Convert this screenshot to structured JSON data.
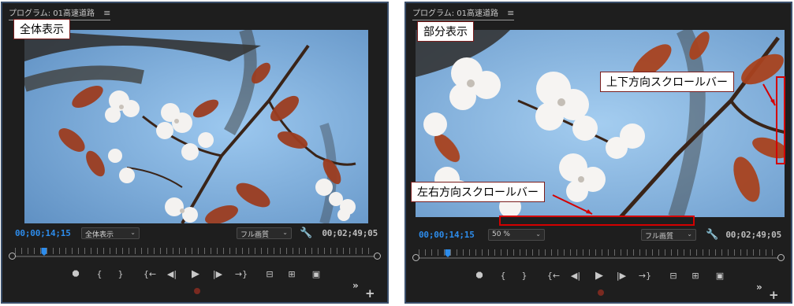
{
  "colors": {
    "panel_bg": "#1e1e1e",
    "panel_border": "#3a4e6a",
    "timecode_current": "#2d8ceb",
    "annotation_red": "#d40000",
    "sky": "#78aee0",
    "leaf": "#9c3d20"
  },
  "left": {
    "header": {
      "title": "プログラム: 01高速道路",
      "menu_icon": "≡"
    },
    "label": "全体表示",
    "timecode_current": "00;00;14;15",
    "zoom_value": "全体表示",
    "quality_value": "フル画質",
    "timecode_total": "00;02;49;05",
    "playhead_position": 0.08
  },
  "right": {
    "header": {
      "title": "プログラム: 01高速道路",
      "menu_icon": "≡"
    },
    "label": "部分表示",
    "vertical_scrollbar_label": "上下方向スクロールバー",
    "horizontal_scrollbar_label": "左右方向スクロールバー",
    "timecode_current": "00;00;14;15",
    "zoom_value": "50 %",
    "quality_value": "フル画質",
    "timecode_total": "00;02;49;05",
    "playhead_position": 0.08
  },
  "transport": {
    "marker": "⯃",
    "mark_in": "{",
    "mark_out": "}",
    "go_to_in": "{←",
    "step_back": "◀|",
    "play": "▶",
    "step_forward": "|▶",
    "go_to_out": "→}",
    "lift": "⊟",
    "extract": "⊞",
    "export_frame": "▣",
    "add_button": "+",
    "more_button": "»",
    "caret": "⌄",
    "wrench": "🔧"
  }
}
